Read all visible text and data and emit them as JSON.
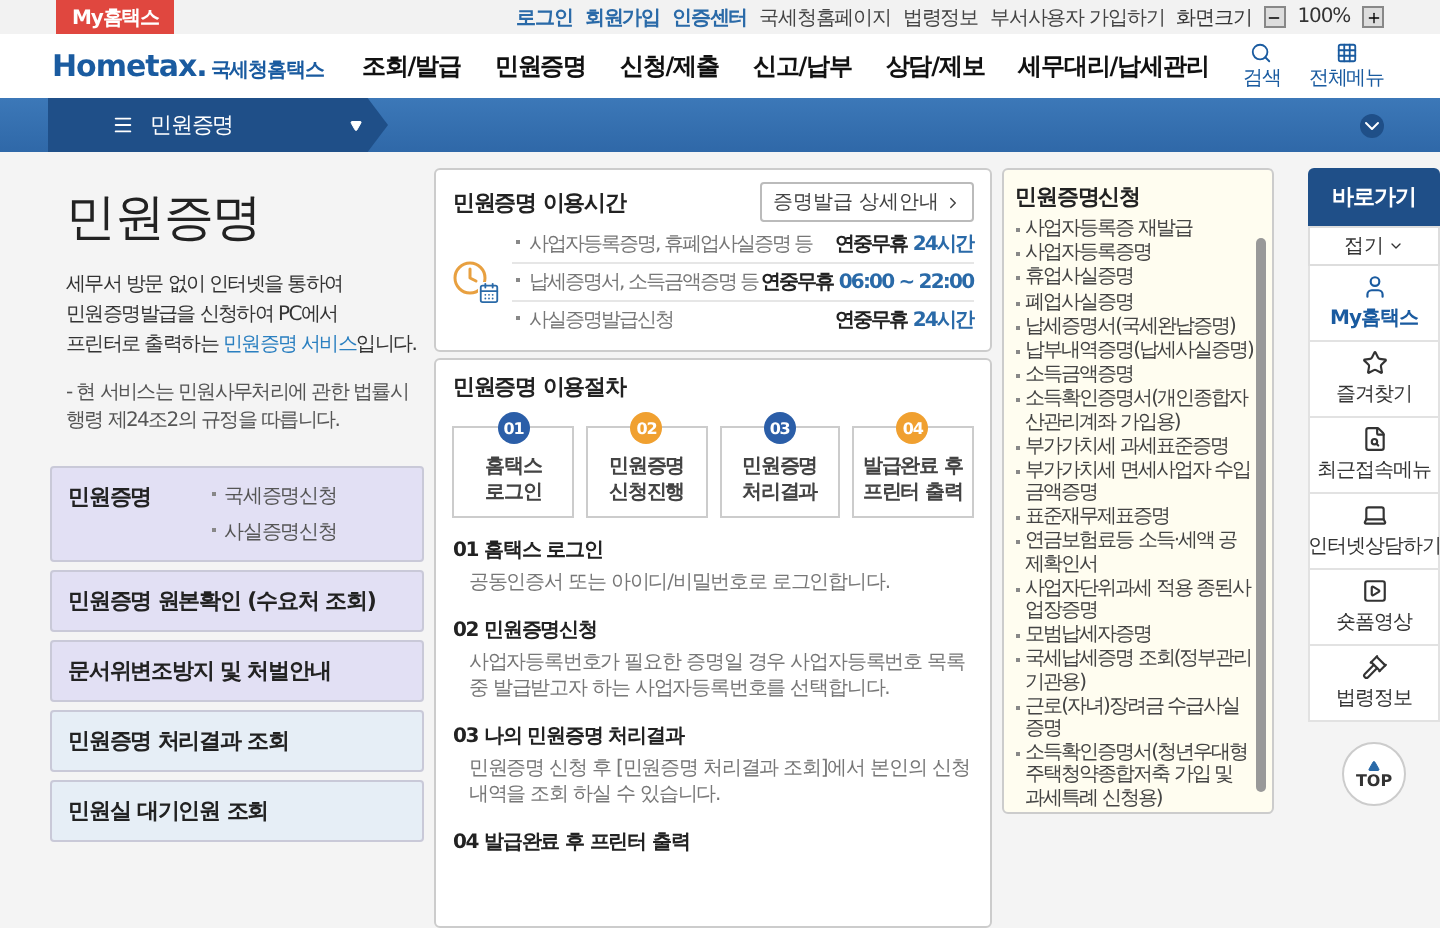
{
  "top_bar": {
    "my_tab": "My홈택스",
    "links": [
      {
        "label": "로그인",
        "kind": "primary"
      },
      {
        "label": "회원가입",
        "kind": "primary"
      },
      {
        "label": "인증센터",
        "kind": "primary"
      },
      {
        "label": "국세청홈페이지",
        "kind": "plain"
      },
      {
        "label": "법령정보",
        "kind": "plain"
      },
      {
        "label": "부서사용자 가입하기",
        "kind": "plain"
      }
    ],
    "zoom_label": "화면크기",
    "zoom_value": "100%"
  },
  "header": {
    "logo": "Hometax.",
    "logo_sub": "국세청홈택스",
    "menu": [
      "조회/발급",
      "민원증명",
      "신청/제출",
      "신고/납부",
      "상담/제보",
      "세무대리/납세관리"
    ],
    "search": "검색",
    "all_menu": "전체메뉴"
  },
  "breadcrumb": {
    "label": "민원증명"
  },
  "intro": {
    "title": "민원증명",
    "lines": [
      "세무서 방문 없이 인터넷을 통하여",
      "민원증명발급을 신청하여 PC에서"
    ],
    "last_before": "프린터로 출력하는 ",
    "link": "민원증명 서비스",
    "last_after": "입니다.",
    "note": "- 현 서비스는 민원사무처리에 관한 법률시행령 제24조2의 규정을 따릅니다."
  },
  "side_menu": [
    {
      "label": "민원증명",
      "color": "#e2e0f4",
      "sub": [
        "국세증명신청",
        "사실증명신청"
      ]
    },
    {
      "label": "민원증명 원본확인 (수요처 조회)",
      "color": "#e2e0f4"
    },
    {
      "label": "문서위변조방지 및 처벌안내",
      "color": "#e2e0f4"
    },
    {
      "label": "민원증명 처리결과 조회",
      "color": "#e6eef6"
    },
    {
      "label": "민원실 대기인원 조회",
      "color": "#e6eef6"
    }
  ],
  "hours": {
    "title": "민원증명 이용시간",
    "detail_button": "증명발급 상세안내",
    "rows": [
      {
        "name": "사업자등록증명, 휴폐업사실증명 등",
        "prefix": "연중무휴",
        "time": "24시간"
      },
      {
        "name": "납세증명서, 소득금액증명 등",
        "prefix": "연중무휴",
        "time": "06:00 ~ 22:00"
      },
      {
        "name": "사실증명발급신청",
        "prefix": "연중무휴",
        "time": "24시간"
      }
    ]
  },
  "procedure": {
    "title": "민원증명 이용절차",
    "steps": [
      {
        "num": "01",
        "label": "홈택스\n로그인",
        "color": "#2b5ea8"
      },
      {
        "num": "02",
        "label": "민원증명\n신청진행",
        "color": "#f0a030"
      },
      {
        "num": "03",
        "label": "민원증명\n처리결과",
        "color": "#2b5ea8"
      },
      {
        "num": "04",
        "label": "발급완료 후\n프린터 출력",
        "color": "#f0a030"
      }
    ],
    "details": [
      {
        "heading": "01 홈택스 로그인",
        "text": "공동인증서 또는 아이디/비밀번호로 로그인합니다."
      },
      {
        "heading": "02 민원증명신청",
        "text": "사업자등록번호가 필요한 증명일 경우 사업자등록번호 목록 중 발급받고자 하는 사업자등록번호를 선택합니다."
      },
      {
        "heading": "03 나의 민원증명 처리결과",
        "text": "민원증명 신청 후 [민원증명 처리결과 조회]에서 본인의 신청내역을 조회 하실 수 있습니다."
      },
      {
        "heading": "04 발급완료 후 프린터 출력"
      }
    ]
  },
  "apply_list": {
    "title": "민원증명신청",
    "items": [
      "사업자등록증 재발급",
      "사업자등록증명",
      "휴업사실증명",
      "폐업사실증명",
      "납세증명서(국세완납증명)",
      "납부내역증명(납세사실증명)",
      "소득금액증명",
      "소득확인증명서(개인종합자산관리계좌 가입용)",
      "부가가치세 과세표준증명",
      "부가가치세 면세사업자 수입금액증명",
      "표준재무제표증명",
      "연금보험료등 소득·세액 공제확인서",
      "사업자단위과세 적용 종된사업장증명",
      "모범납세자증명",
      "국세납세증명 조회(정부관리기관용)",
      "근로(자녀)장려금 수급사실 증명",
      "소득확인증명서(청년우대형주택청약종합저축 가입 및 과세특례 신청용)"
    ]
  },
  "quick": {
    "title": "바로가기",
    "fold": "접기",
    "items": [
      {
        "label": "My홈택스",
        "kind": "user",
        "selected": true
      },
      {
        "label": "즐겨찾기",
        "kind": "star",
        "selected": false
      },
      {
        "label": "최근접속메뉴",
        "kind": "recent",
        "selected": false
      },
      {
        "label": "인터넷상담하기",
        "kind": "laptop",
        "selected": false
      },
      {
        "label": "숏폼영상",
        "kind": "video",
        "selected": false
      },
      {
        "label": "법령정보",
        "kind": "law",
        "selected": false
      }
    ],
    "top": "TOP"
  }
}
